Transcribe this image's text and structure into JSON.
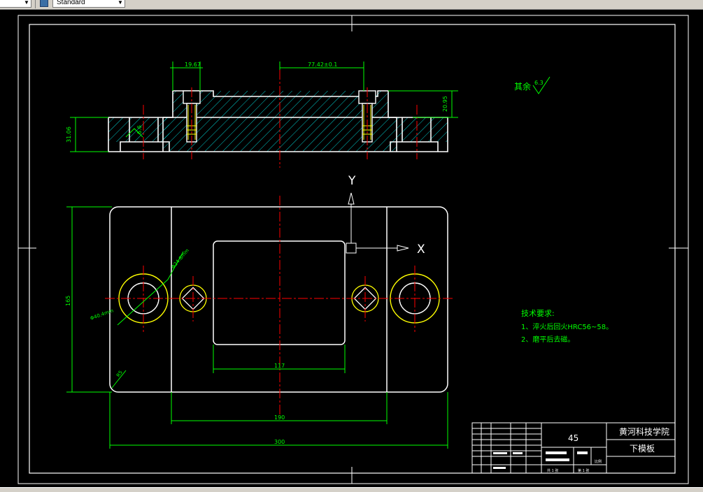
{
  "toolbar": {
    "layer_combo_value": "",
    "style_combo_value": "Standard",
    "style_icon": "text-style-icon"
  },
  "colors": {
    "background": "#000000",
    "outline": "#ffffff",
    "centerline": "#ff0000",
    "dimension": "#00ff00",
    "hatch": "#00ffff",
    "bolt": "#ffff00",
    "annotation": "#00ff00"
  },
  "drawing": {
    "section_view": {
      "dim_top_left": "19.67",
      "dim_top_center": "77.42±0.1",
      "dim_left_height": "31.06",
      "dim_right_height": "20.95",
      "dim_step": "6.6"
    },
    "plan_view": {
      "dim_height": "165",
      "dim_inner_width": "117",
      "dim_mid_width": "190",
      "dim_overall_width": "300",
      "dim_corner": "R5",
      "dim_bolt_hole": "Φ40.4mm",
      "dim_pin_hole": "Φ24.8mm",
      "axis_x": "X",
      "axis_y": "Y"
    },
    "roughness_note": {
      "label": "其余",
      "value": "6.3"
    },
    "tech_requirements": {
      "title": "技术要求:",
      "line1": "1、淬火后回火HRC56~58。",
      "line2": "2、磨平后去磁。"
    },
    "title_block": {
      "material": "45",
      "school": "黄河科技学院",
      "part_name": "下模板",
      "scale_label": "比例",
      "sheet_label": "共 1 张",
      "sheet_label2": "第 1 张"
    }
  }
}
